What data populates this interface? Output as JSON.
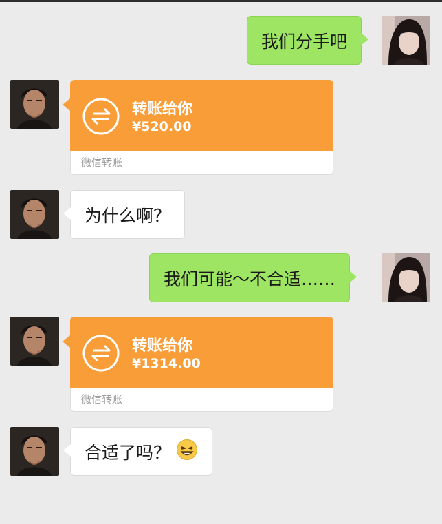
{
  "messages": {
    "m1": {
      "sender": "her",
      "text": "我们分手吧"
    },
    "m2": {
      "sender": "him",
      "type": "transfer",
      "title": "转账给你",
      "amount": "¥520.00",
      "footer": "微信转账"
    },
    "m3": {
      "sender": "him",
      "text": "为什么啊？"
    },
    "m4": {
      "sender": "her",
      "text": "我们可能～不合适……"
    },
    "m5": {
      "sender": "him",
      "type": "transfer",
      "title": "转账给你",
      "amount": "¥1314.00",
      "footer": "微信转账"
    },
    "m6": {
      "sender": "him",
      "text": "合适了吗？",
      "emoji": "grinning-face-emoji"
    }
  },
  "colors": {
    "background": "#ebebeb",
    "green_bubble": "#9de562",
    "white_bubble": "#ffffff",
    "transfer_orange": "#f99d38"
  },
  "icons": {
    "transfer": "transfer-arrows-icon",
    "emoji": "grinning-face-emoji"
  }
}
